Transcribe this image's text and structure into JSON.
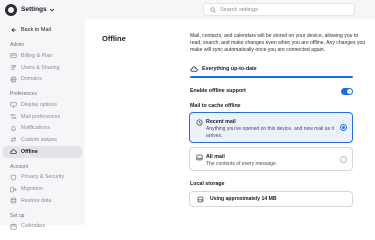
{
  "header": {
    "app_title": "Settings",
    "search_placeholder": "Search settings"
  },
  "sidebar": {
    "back_label": "Back to Mail",
    "sections": [
      {
        "title": "Admin",
        "items": [
          {
            "label": "Billing & Plan",
            "icon": "card-icon"
          },
          {
            "label": "Users & Sharing",
            "icon": "users-icon"
          },
          {
            "label": "Domains",
            "icon": "globe-icon"
          }
        ]
      },
      {
        "title": "Preferences",
        "items": [
          {
            "label": "Display options",
            "icon": "monitor-icon"
          },
          {
            "label": "Mail preferences",
            "icon": "sliders-icon"
          },
          {
            "label": "Notifications",
            "icon": "bell-icon"
          },
          {
            "label": "Custom swipes",
            "icon": "swipe-icon"
          },
          {
            "label": "Offline",
            "icon": "cloud-icon",
            "active": true
          }
        ]
      },
      {
        "title": "Account",
        "items": [
          {
            "label": "Privacy & Security",
            "icon": "shield-icon"
          },
          {
            "label": "Migration",
            "icon": "migration-icon"
          },
          {
            "label": "Restore data",
            "icon": "database-icon"
          }
        ]
      },
      {
        "title": "Set up",
        "items": [
          {
            "label": "Calendars",
            "icon": "calendar-icon"
          }
        ]
      }
    ]
  },
  "main": {
    "title": "Offline",
    "description": "Mail, contacts, and calendars will be stored on your device, allowing you to read, search, and make changes even when you are offline. Any changes you make will sync automatically once you are connected again.",
    "status": "Everything up-to-date",
    "sync_progress_percent": 100,
    "toggle_label": "Enable offline support",
    "toggle_on": true,
    "cache_label": "Mail to cache offline",
    "options": [
      {
        "title": "Recent mail",
        "description": "Anything you've opened on this device, and new mail as it arrives.",
        "selected": true
      },
      {
        "title": "All mail",
        "description": "The contents of every message.",
        "selected": false
      }
    ],
    "local_storage_label": "Local storage",
    "storage_text": "Using approximately 14 MB"
  },
  "colors": {
    "accent": "#1b6fd8",
    "sidebar_bg": "#f6f6f8",
    "selected_option_bg": "#ecf2fd"
  }
}
